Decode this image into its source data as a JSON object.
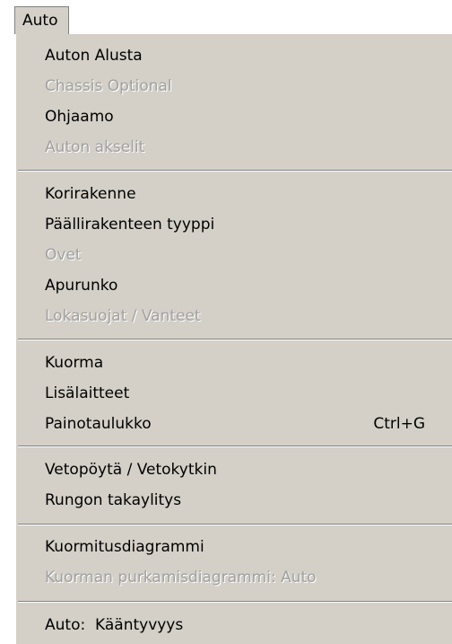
{
  "menu": {
    "title": "Auto",
    "groups": [
      [
        {
          "label": "Auton Alusta",
          "enabled": true
        },
        {
          "label": "Chassis Optional",
          "enabled": false
        },
        {
          "label": "Ohjaamo",
          "enabled": true
        },
        {
          "label": "Auton akselit",
          "enabled": false
        }
      ],
      [
        {
          "label": "Korirakenne",
          "enabled": true
        },
        {
          "label": "Päällirakenteen tyyppi",
          "enabled": true
        },
        {
          "label": "Ovet",
          "enabled": false
        },
        {
          "label": "Apurunko",
          "enabled": true
        },
        {
          "label": "Lokasuojat / Vanteet",
          "enabled": false
        }
      ],
      [
        {
          "label": "Kuorma",
          "enabled": true
        },
        {
          "label": "Lisälaitteet",
          "enabled": true
        },
        {
          "label": "Painotaulukko",
          "enabled": true,
          "shortcut": "Ctrl+G"
        }
      ],
      [
        {
          "label": "Vetopöytä / Vetokytkin",
          "enabled": true
        },
        {
          "label": "Rungon takaylitys",
          "enabled": true
        }
      ],
      [
        {
          "label": "Kuormitusdiagrammi",
          "enabled": true
        },
        {
          "label": "Kuorman purkamisdiagrammi: Auto",
          "enabled": false
        }
      ],
      [
        {
          "label": "Auto:  Kääntyvyys",
          "enabled": true
        }
      ]
    ]
  },
  "colors": {
    "menu_face": "#d4d0c8",
    "disabled_text": "#a0a0a0",
    "text": "#000000"
  }
}
